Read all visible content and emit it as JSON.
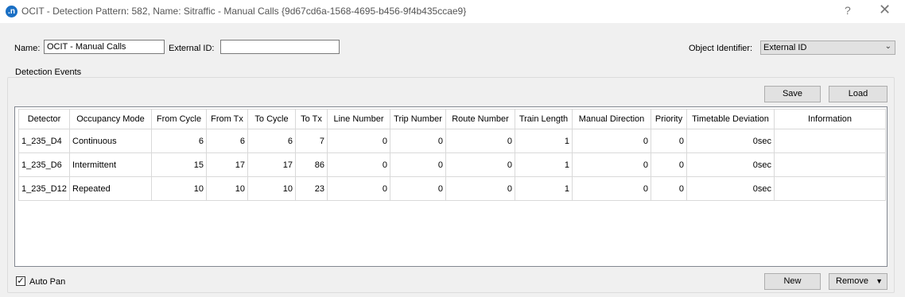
{
  "window": {
    "app_icon": ".n",
    "title": "OCIT - Detection Pattern: 582, Name: Sitraffic - Manual Calls {9d67cd6a-1568-4695-b456-9f4b435ccae9}",
    "help": "?",
    "close": "✕"
  },
  "form": {
    "name_label": "Name:",
    "name_value": "OCIT - Manual Calls",
    "external_id_label": "External ID:",
    "external_id_value": "",
    "object_identifier_label": "Object Identifier:",
    "object_identifier_value": "External ID"
  },
  "events": {
    "group_title": "Detection Events",
    "save_label": "Save",
    "load_label": "Load",
    "columns": [
      "Detector",
      "Occupancy Mode",
      "From Cycle",
      "From Tx",
      "To Cycle",
      "To Tx",
      "Line Number",
      "Trip Number",
      "Route Number",
      "Train Length",
      "Manual Direction",
      "Priority",
      "Timetable Deviation",
      "Information"
    ],
    "rows": [
      [
        "1_235_D4",
        "Continuous",
        "6",
        "6",
        "6",
        "7",
        "0",
        "0",
        "0",
        "1",
        "0",
        "0",
        "0sec",
        ""
      ],
      [
        "1_235_D6",
        "Intermittent",
        "15",
        "17",
        "17",
        "86",
        "0",
        "0",
        "0",
        "1",
        "0",
        "0",
        "0sec",
        ""
      ],
      [
        "1_235_D12",
        "Repeated",
        "10",
        "10",
        "10",
        "23",
        "0",
        "0",
        "0",
        "1",
        "0",
        "0",
        "0sec",
        ""
      ]
    ]
  },
  "footer": {
    "auto_pan_label": "Auto Pan",
    "auto_pan_checked": "✓",
    "new_label": "New",
    "remove_label": "Remove",
    "remove_arrow": "▼"
  }
}
